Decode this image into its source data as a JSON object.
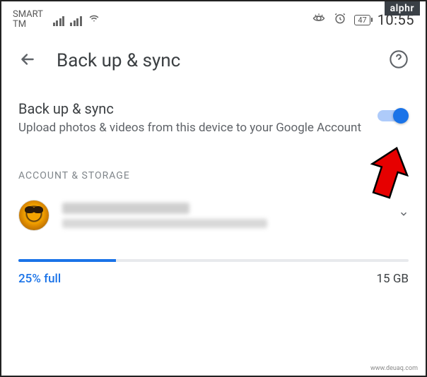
{
  "meta": {
    "badge": "alphr",
    "watermark": "www.deuaq.com"
  },
  "status": {
    "carrier_line1": "SMART",
    "carrier_line2": "TM",
    "battery": "47",
    "time": "10:55"
  },
  "header": {
    "title": "Back up & sync"
  },
  "main": {
    "backup": {
      "title": "Back up & sync",
      "description": "Upload photos & videos from this device to your Google Account",
      "toggle_on": true
    },
    "section_label": "ACCOUNT & STORAGE",
    "account": {
      "name_redacted": true,
      "email_redacted": true
    },
    "storage": {
      "percent": 25,
      "percent_label": "25% full",
      "total_label": "15 GB",
      "fill_style": "width:25%"
    }
  },
  "colors": {
    "accent": "#1a73e8",
    "text_primary": "#3c4043",
    "text_secondary": "#5f6368",
    "annotation_arrow": "#e60000"
  }
}
